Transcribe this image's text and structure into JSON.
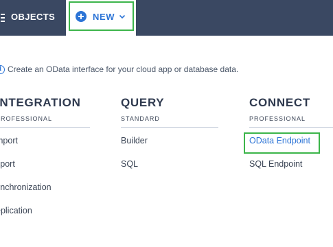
{
  "header": {
    "objects_label": "OBJECTS",
    "new_label": "NEW",
    "new_icon": "plus-circle-icon",
    "new_chevron": "⌄"
  },
  "info": {
    "icon_glyph": "i",
    "text": "Create an OData interface for your cloud app or database data."
  },
  "columns": [
    {
      "title": "INTEGRATION",
      "subtitle": "PROFESSIONAL",
      "items": [
        "mport",
        "xport",
        "ynchronization",
        "eplication"
      ]
    },
    {
      "title": "QUERY",
      "subtitle": "STANDARD",
      "items": [
        "Builder",
        "SQL"
      ]
    },
    {
      "title": "CONNECT",
      "subtitle": "PROFESSIONAL",
      "items": [
        "OData Endpoint",
        "SQL Endpoint"
      ]
    }
  ],
  "colors": {
    "topbar": "#3a4862",
    "accent": "#2c74d6",
    "highlight": "#3cb54a"
  }
}
